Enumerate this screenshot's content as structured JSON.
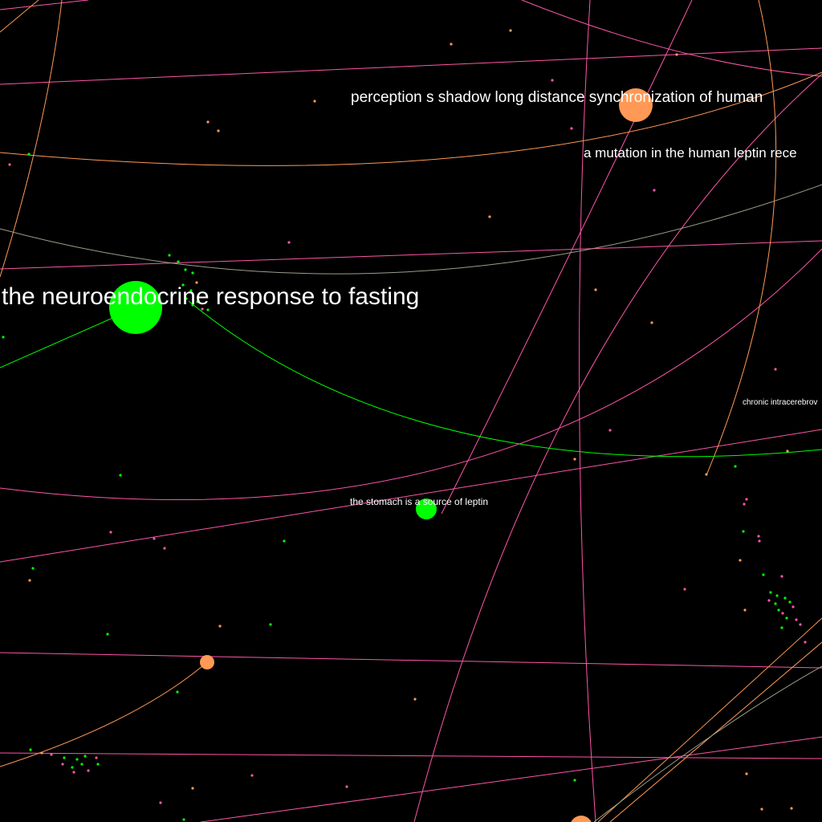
{
  "colors": {
    "background": "#000000",
    "green": "#00ff00",
    "orange": "#ff9955",
    "pink": "#ff55aa",
    "label": "#ffffff"
  },
  "labels": {
    "neuroendocrine": "the neuroendocrine response to fasting",
    "perception": "perception s shadow long distance synchronization of human",
    "mutation": "a mutation in the human leptin rece",
    "chronic": "chronic intracerebrov",
    "stomach": "the stomach is a source of leptin"
  }
}
